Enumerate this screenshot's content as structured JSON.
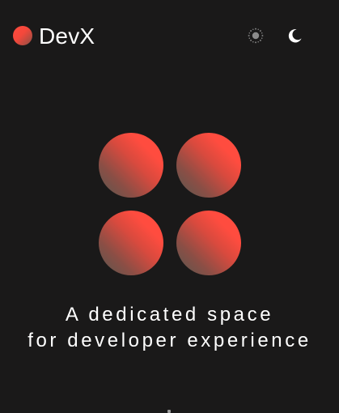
{
  "header": {
    "brand": "DevX",
    "theme_light_icon": "sun-icon",
    "theme_dark_icon": "moon-icon"
  },
  "hero": {
    "tagline_line1": "A dedicated space",
    "tagline_line2": "for developer experience"
  },
  "colors": {
    "background": "#1a1919",
    "accent": "#ff4a3d",
    "accent_muted": "#56574f",
    "text": "#ffffff"
  }
}
